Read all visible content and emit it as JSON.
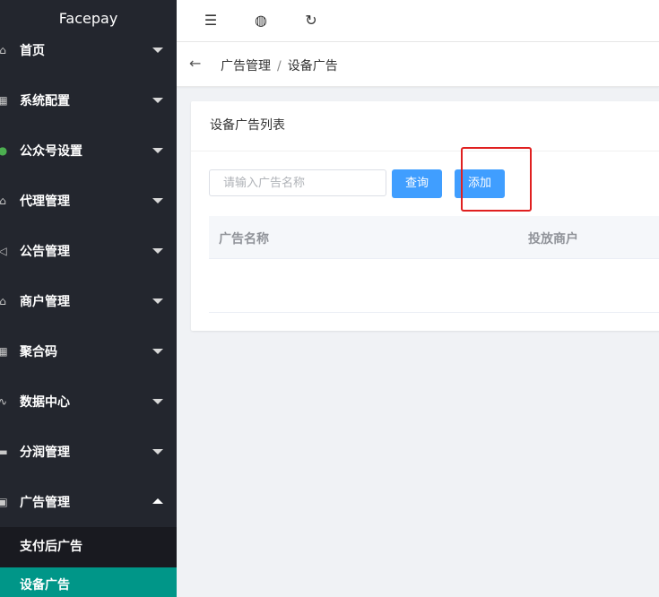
{
  "brand": "Facepay",
  "menu": [
    {
      "label": "首页",
      "icon": "home-icon"
    },
    {
      "label": "系统配置",
      "icon": "settings-grid-icon"
    },
    {
      "label": "公众号设置",
      "icon": "wechat-icon"
    },
    {
      "label": "代理管理",
      "icon": "home-icon"
    },
    {
      "label": "公告管理",
      "icon": "speaker-icon"
    },
    {
      "label": "商户管理",
      "icon": "home-icon"
    },
    {
      "label": "聚合码",
      "icon": "grid-icon"
    },
    {
      "label": "数据中心",
      "icon": "pulse-icon"
    },
    {
      "label": "分润管理",
      "icon": "chat-icon"
    },
    {
      "label": "广告管理",
      "icon": "calendar-icon"
    }
  ],
  "submenu": [
    {
      "label": "支付后广告"
    },
    {
      "label": "设备广告"
    }
  ],
  "topbar": {
    "icons": [
      "menu-fold-icon",
      "globe-icon",
      "refresh-icon"
    ]
  },
  "breadcrumb": {
    "parent": "广告管理",
    "separator": "/",
    "current": "设备广告"
  },
  "card": {
    "title": "设备广告列表",
    "search_placeholder": "请输入广告名称",
    "search_value": "",
    "query_label": "查询",
    "add_label": "添加",
    "columns": [
      "广告名称",
      "投放商户"
    ],
    "rows": []
  },
  "colors": {
    "sidebar": "#23262e",
    "submenu": "#191a20",
    "active": "#009688",
    "primary": "#409eff",
    "highlight": "#e02020"
  }
}
